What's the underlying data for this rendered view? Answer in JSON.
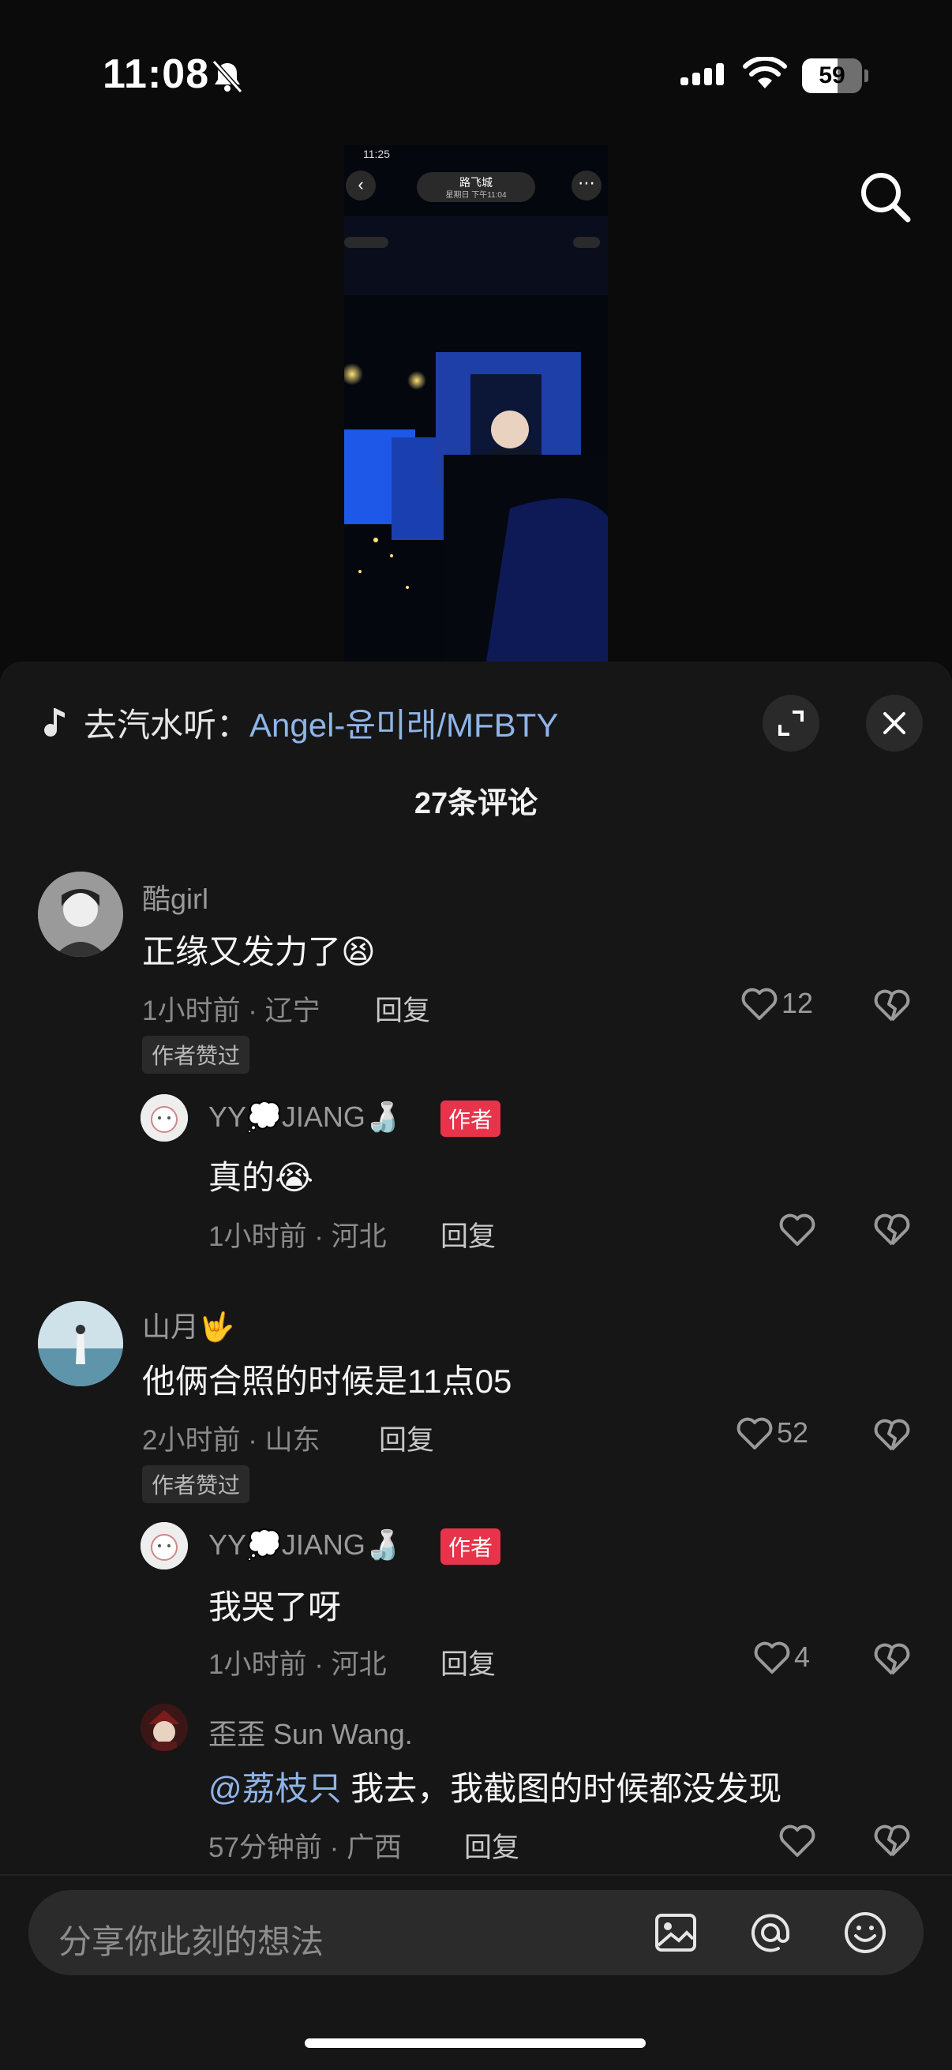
{
  "status_bar": {
    "time": "11:08",
    "battery": "59",
    "battery_fraction": 0.59
  },
  "video_preview": {
    "time": "11:25",
    "title": "路飞城",
    "subtitle": "星期日 下午11:04",
    "back_glyph": "‹",
    "more_glyph": "⋯"
  },
  "sheet": {
    "music_prefix": "去汽水听：",
    "music_song": "Angel-윤미래/MFBTY",
    "comment_count": "27条评论"
  },
  "comments": [
    {
      "user": "酷girl",
      "text": "正缘又发力了😫",
      "time_location": "1小时前 · 辽宁",
      "reply_label": "回复",
      "likes": "12",
      "author_liked": "作者赞过",
      "replies": [
        {
          "user": "YY💭JIANG🍶",
          "author_tag": "作者",
          "text": "真的😭",
          "time_location": "1小时前 · 河北",
          "reply_label": "回复",
          "likes": ""
        }
      ]
    },
    {
      "user": "山月🤟",
      "text": "他俩合照的时候是11点05",
      "time_location": "2小时前 · 山东",
      "reply_label": "回复",
      "likes": "52",
      "author_liked": "作者赞过",
      "replies": [
        {
          "user": "YY💭JIANG🍶",
          "author_tag": "作者",
          "text": "我哭了呀",
          "time_location": "1小时前 · 河北",
          "reply_label": "回复",
          "likes": "4"
        },
        {
          "user": "歪歪 Sun Wang.",
          "mention": "@荔枝只",
          "text": " 我去，我截图的时候都没发现",
          "time_location": "57分钟前 · 广西",
          "reply_label": "回复",
          "likes": ""
        }
      ]
    }
  ],
  "input": {
    "placeholder": "分享你此刻的想法"
  },
  "icons": [
    "bell-slash-icon",
    "signal-icon",
    "wifi-icon",
    "battery-icon",
    "search-icon",
    "music-note-icon",
    "expand-icon",
    "close-icon",
    "heart-icon",
    "heart-broken-icon",
    "image-icon",
    "at-icon",
    "emoji-icon"
  ]
}
